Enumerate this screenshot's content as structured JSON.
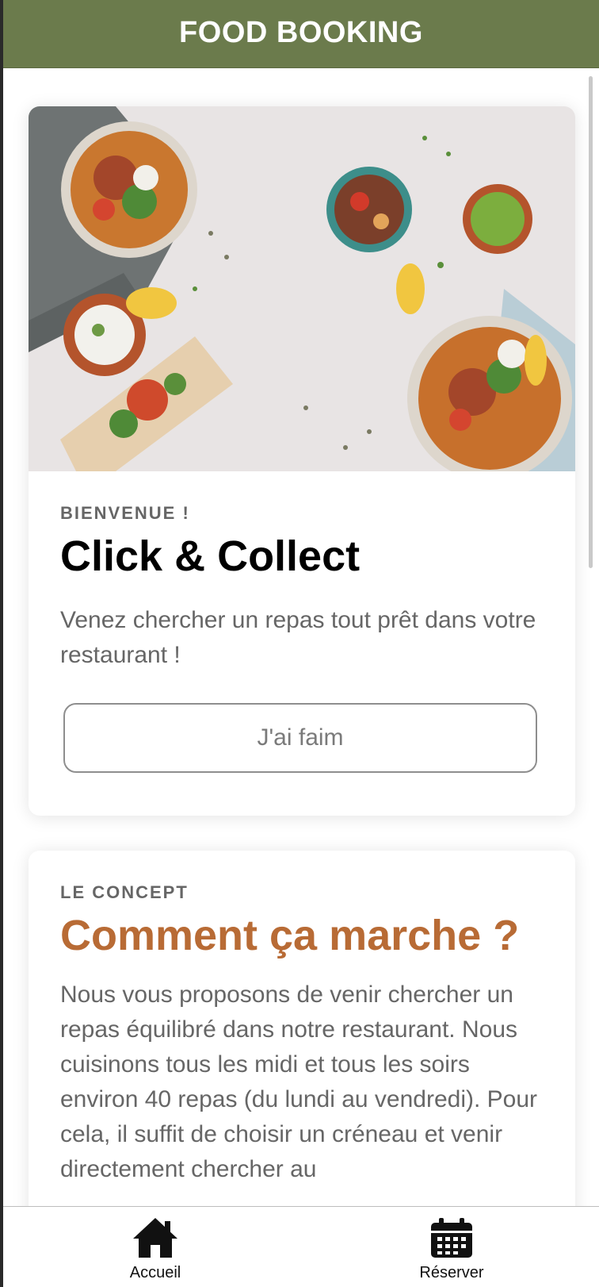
{
  "header": {
    "title": "FOOD BOOKING"
  },
  "welcome_card": {
    "hero_image": "food-bowls-photo",
    "eyebrow": "BIENVENUE !",
    "title": "Click & Collect",
    "description": "Venez chercher un repas tout prêt dans votre restaurant !",
    "button_label": "J'ai faim"
  },
  "concept_card": {
    "eyebrow": "LE CONCEPT",
    "title": "Comment ça marche ?",
    "title_color": "#b86b35",
    "description": "Nous vous proposons de venir chercher un repas équilibré dans notre restaurant. Nous cuisinons tous les midi et tous les soirs environ 40 repas (du lundi au vendredi). Pour cela, il suffit de choisir un créneau et venir directement chercher au"
  },
  "tabs": [
    {
      "label": "Accueil",
      "icon": "home-icon"
    },
    {
      "label": "Réserver",
      "icon": "calendar-icon"
    }
  ],
  "colors": {
    "header_bg": "#6b7b4c",
    "accent": "#b86b35"
  }
}
